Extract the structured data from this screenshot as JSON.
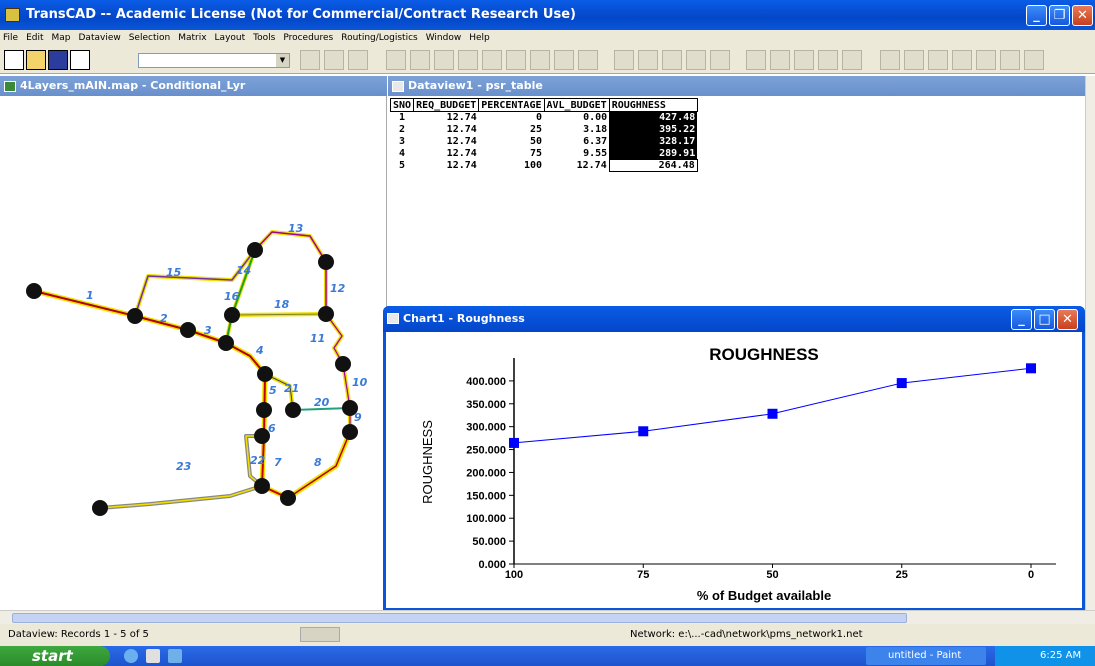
{
  "app": {
    "title": "TransCAD -- Academic License (Not for Commercial/Contract Research Use)"
  },
  "menu": [
    "File",
    "Edit",
    "Map",
    "Dataview",
    "Selection",
    "Matrix",
    "Layout",
    "Tools",
    "Procedures",
    "Routing/Logistics",
    "Window",
    "Help"
  ],
  "map_window": {
    "title": "4Layers_mAIN.map - Conditional_Lyr",
    "link_labels": [
      "1",
      "2",
      "3",
      "4",
      "5",
      "6",
      "7",
      "8",
      "9",
      "10",
      "11",
      "12",
      "13",
      "14",
      "15",
      "16",
      "18",
      "20",
      "21",
      "22",
      "23"
    ]
  },
  "dataview": {
    "title": "Dataview1 - psr_table",
    "columns": [
      "SNO",
      "REQ_BUDGET",
      "PERCENTAGE",
      "AVL_BUDGET",
      "ROUGHNESS"
    ],
    "rows": [
      [
        "1",
        "12.74",
        "0",
        "0.00",
        "427.48"
      ],
      [
        "2",
        "12.74",
        "25",
        "3.18",
        "395.22"
      ],
      [
        "3",
        "12.74",
        "50",
        "6.37",
        "328.17"
      ],
      [
        "4",
        "12.74",
        "75",
        "9.55",
        "289.91"
      ],
      [
        "5",
        "12.74",
        "100",
        "12.74",
        "264.48"
      ]
    ]
  },
  "chart_window": {
    "title": "Chart1 - Roughness"
  },
  "chart_data": {
    "type": "line",
    "title": "ROUGHNESS",
    "xlabel": "% of Budget available",
    "ylabel": "ROUGHNESS",
    "categories": [
      "100",
      "75",
      "50",
      "25",
      "0"
    ],
    "series": [
      {
        "name": "ROUGHNESS",
        "values": [
          264.48,
          289.91,
          328.17,
          395.22,
          427.48
        ]
      }
    ],
    "y_ticks": [
      "0.000",
      "50.000",
      "100.000",
      "150.000",
      "200.000",
      "250.000",
      "300.000",
      "350.000",
      "400.000"
    ],
    "ylim": [
      0,
      450
    ],
    "grid": false,
    "color": "#0000ff"
  },
  "status": {
    "left": "Dataview: Records 1 - 5 of 5",
    "right": "Network: e:\\...-cad\\network\\pms_network1.net"
  },
  "taskbar": {
    "start": "start",
    "paint": "untitled - Paint",
    "clock": "6:25 AM"
  }
}
